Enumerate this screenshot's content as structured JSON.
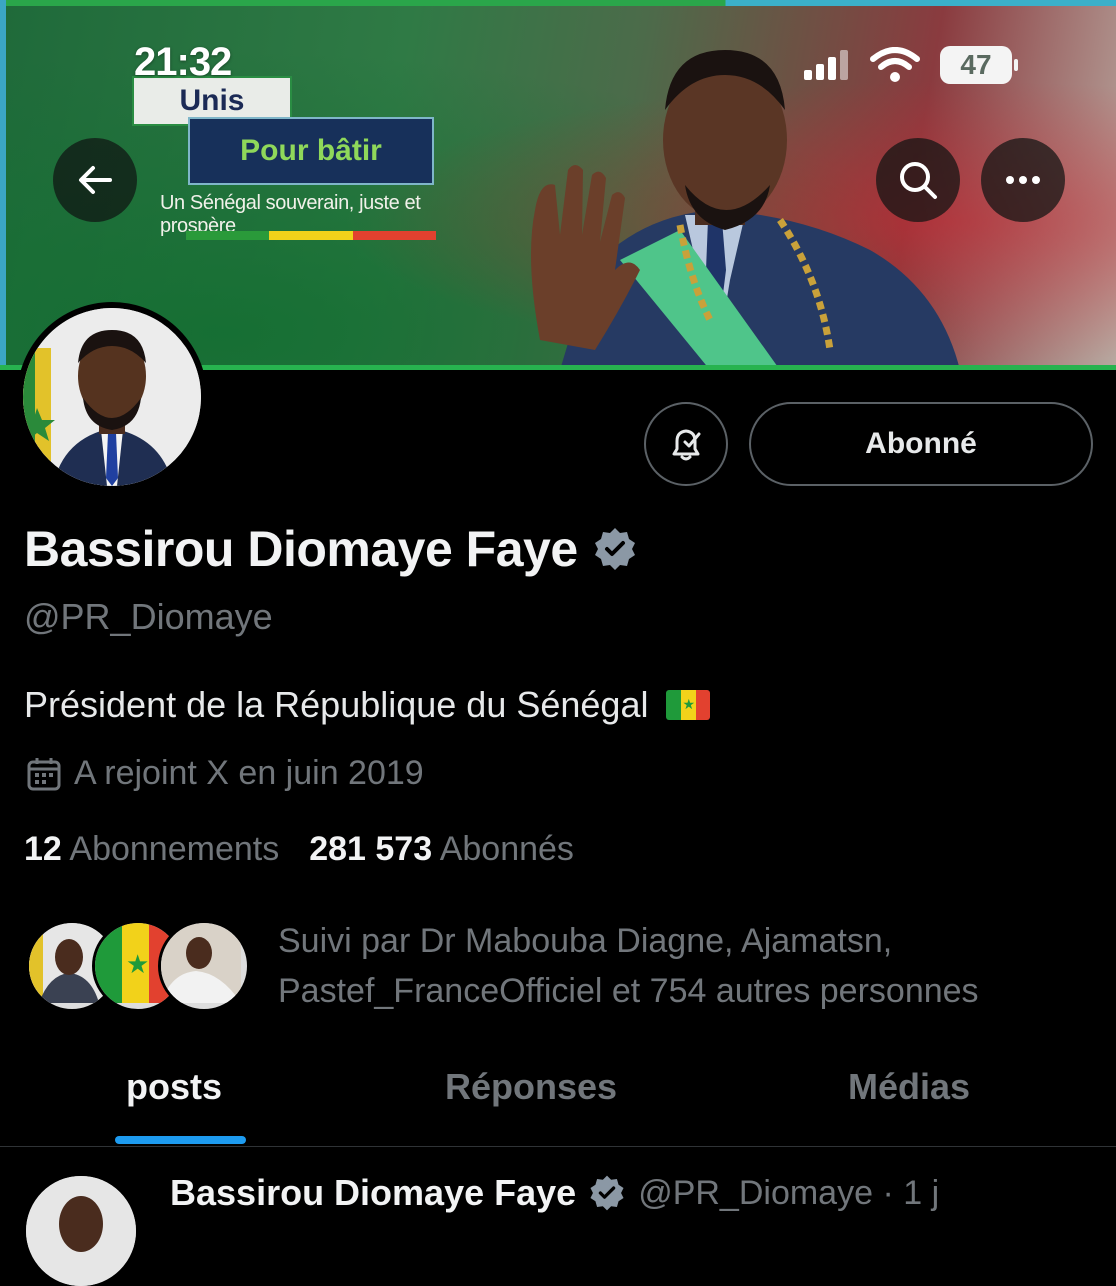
{
  "status_bar": {
    "time": "21:32",
    "battery": "47"
  },
  "banner": {
    "line1": "Unis",
    "line2": "Pour bâtir",
    "slogan": "Un Sénégal souverain, juste et prospère",
    "flag_colors": [
      "#2a9a3a",
      "#f1d21a",
      "#e2412f"
    ]
  },
  "nav": {
    "back_icon": "arrow-left-icon",
    "search_icon": "search-icon",
    "more_icon": "more-icon"
  },
  "profile": {
    "follow_button": "Abonné",
    "name": "Bassirou Diomaye Faye",
    "handle": "@PR_Diomaye",
    "bio": "Président de la République du Sénégal",
    "bio_flag": "🇸🇳",
    "joined": "A rejoint X en juin 2019",
    "following_count": "12",
    "following_label": "Abonnements",
    "followers_count": "281 573",
    "followers_label": "Abonnés",
    "followed_by": "Suivi par Dr Mabouba Diagne, Ajamatsn, Pastef_FranceOfficiel et 754 autres personnes"
  },
  "tabs": [
    {
      "label": "posts",
      "active": true
    },
    {
      "label": "Réponses",
      "active": false
    },
    {
      "label": "Médias",
      "active": false
    }
  ],
  "post_preview": {
    "name": "Bassirou Diomaye Faye",
    "meta": "@PR_Diomaye · 1 j"
  },
  "colors": {
    "accent": "#1d9bf0",
    "muted": "#71767b",
    "background": "#000000",
    "verified": "#8b98a5"
  }
}
